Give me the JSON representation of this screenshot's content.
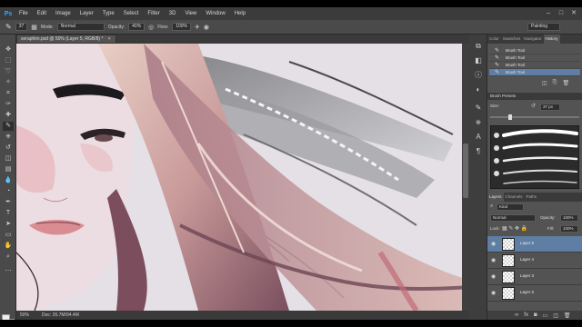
{
  "app": {
    "logo": "Ps"
  },
  "menu": [
    "File",
    "Edit",
    "Image",
    "Layer",
    "Type",
    "Select",
    "Filter",
    "3D",
    "View",
    "Window",
    "Help"
  ],
  "window_controls": [
    "–",
    "□",
    "✕"
  ],
  "options_bar": {
    "brush_size": "37",
    "mode_label": "Mode:",
    "mode_value": "Normal",
    "opacity_label": "Opacity:",
    "opacity_value": "40%",
    "flow_label": "Flow:",
    "flow_value": "100%",
    "workspace": "Painting"
  },
  "document_tab": {
    "title": "seraphim.psd @ 50% (Layer 5, RGB/8) *",
    "close": "×"
  },
  "status_bar": {
    "zoom": "50%",
    "doc": "Doc: 26.7M/94.4M"
  },
  "history_panel": {
    "tabs": [
      "Color",
      "Swatches",
      "Navigator",
      "History"
    ],
    "active_tab": "History",
    "items": [
      "Brush Tool",
      "Brush Tool",
      "Brush Tool",
      "Brush Tool"
    ],
    "selected_index": 3
  },
  "brush_presets": {
    "title": "Brush Presets",
    "size_label": "Size:",
    "size_value": "37 px"
  },
  "layers_panel": {
    "tabs": [
      "Layers",
      "Channels",
      "Paths"
    ],
    "active_tab": "Layers",
    "kind_label": "Kind",
    "blend_mode": "Normal",
    "opacity_label": "Opacity:",
    "opacity_value": "100%",
    "lock_label": "Lock:",
    "fill_label": "Fill:",
    "fill_value": "100%",
    "layers": [
      "Layer 5",
      "Layer 4",
      "Layer 3",
      "Layer 2"
    ],
    "selected_index": 0
  },
  "colors": {
    "accent": "#5e7ea3",
    "foreground": "#f0eded",
    "background": "#c95a66",
    "ps_blue": "#31a8ff"
  }
}
